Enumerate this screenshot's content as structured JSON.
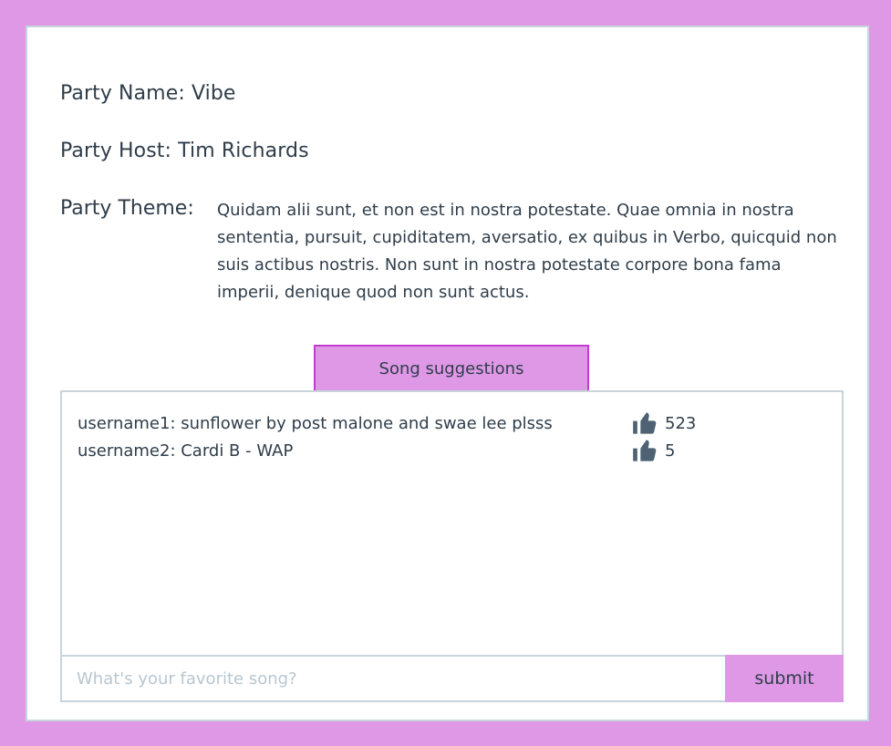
{
  "party": {
    "name_line": "Party Name: Vibe",
    "host_line": "Party Host: Tim Richards",
    "theme_label": "Party Theme:",
    "theme_text": "Quidam alii sunt, et non est in nostra potestate. Quae omnia in nostra sententia, pursuit, cupiditatem, aversatio, ex quibus in Verbo, quicquid non suis actibus nostris. Non sunt in nostra potestate corpore bona fama imperii, denique quod non sunt actus."
  },
  "suggestions": {
    "tab_label": "Song suggestions",
    "items": [
      {
        "text": "username1: sunflower by post malone and swae lee plsss",
        "icon": "thumbs-up-icon",
        "likes": "523"
      },
      {
        "text": "username2: Cardi B - WAP",
        "icon": "thumbs-up-icon",
        "likes": "5"
      }
    ],
    "input_placeholder": "What's your favorite song?",
    "input_value": "",
    "submit_label": "submit"
  },
  "colors": {
    "background": "#de98e6",
    "accent_border": "#c33cd1",
    "card_border": "#c8d3dc",
    "text": "#2f3d4a",
    "icon": "#4e6273"
  }
}
